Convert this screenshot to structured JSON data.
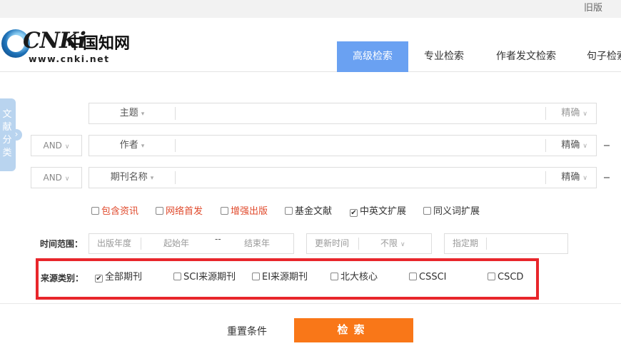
{
  "topbar": {
    "old_version": "旧版"
  },
  "logo": {
    "word": "CNKi",
    "cn_name": "中国知网",
    "url": "www.cnki.net"
  },
  "tabs": [
    {
      "label": "高级检索",
      "active": true
    },
    {
      "label": "专业检索"
    },
    {
      "label": "作者发文检索"
    },
    {
      "label": "句子检索"
    }
  ],
  "side_tab": {
    "label": "文献分类"
  },
  "search_rows": [
    {
      "logic": "",
      "field": "主题",
      "exact": "精确"
    },
    {
      "logic": "AND",
      "field": "作者",
      "exact": "精确"
    },
    {
      "logic": "AND",
      "field": "期刊名称",
      "exact": "精确"
    }
  ],
  "options": [
    {
      "label": "包含资讯",
      "checked": false,
      "color": "#e04a2c"
    },
    {
      "label": "网络首发",
      "checked": false,
      "color": "#e04a2c"
    },
    {
      "label": "增强出版",
      "checked": false,
      "color": "#e04a2c"
    },
    {
      "label": "基金文献",
      "checked": false
    },
    {
      "label": "中英文扩展",
      "checked": true
    },
    {
      "label": "同义词扩展",
      "checked": false
    }
  ],
  "time_range": {
    "label": "时间范围：",
    "pub_year": "出版年度",
    "start_year": "起始年",
    "dash": "--",
    "end_year": "结束年",
    "update_time": "更新时间",
    "update_value": "不限",
    "specify": "指定期"
  },
  "source": {
    "label": "来源类别：",
    "items": [
      {
        "label": "全部期刊",
        "checked": true
      },
      {
        "label": "SCI来源期刊",
        "checked": false
      },
      {
        "label": "EI来源期刊",
        "checked": false
      },
      {
        "label": "北大核心",
        "checked": false
      },
      {
        "label": "CSSCI",
        "checked": false
      },
      {
        "label": "CSCD",
        "checked": false
      }
    ]
  },
  "actions": {
    "reset": "重置条件",
    "search": "检索"
  },
  "colors": {
    "accent": "#6aa1f2",
    "highlight_border": "#e8262b",
    "search_button": "#f97718"
  }
}
